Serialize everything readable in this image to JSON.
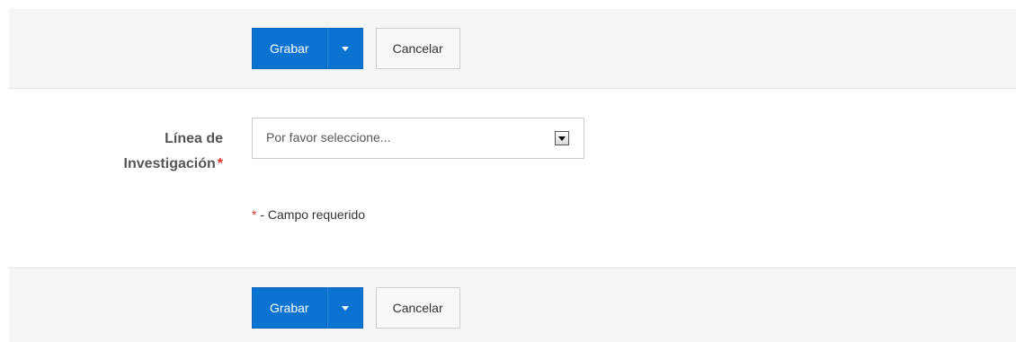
{
  "top_bar": {
    "save_label": "Grabar",
    "cancel_label": "Cancelar"
  },
  "form": {
    "field_label_line1": "Línea de",
    "field_label_line2": "Investigación",
    "required_marker": "*",
    "select_value": "Por favor seleccione...",
    "required_note_marker": "*",
    "required_note_text": " - Campo requerido"
  },
  "bottom_bar": {
    "save_label": "Grabar",
    "cancel_label": "Cancelar"
  },
  "icons": {
    "dropdown_caret": "chevron-down-icon",
    "select_arrow": "select-arrow-icon"
  },
  "colors": {
    "primary": "#0b73d1",
    "required": "#d9302b",
    "bar_background": "#f5f5f5"
  }
}
